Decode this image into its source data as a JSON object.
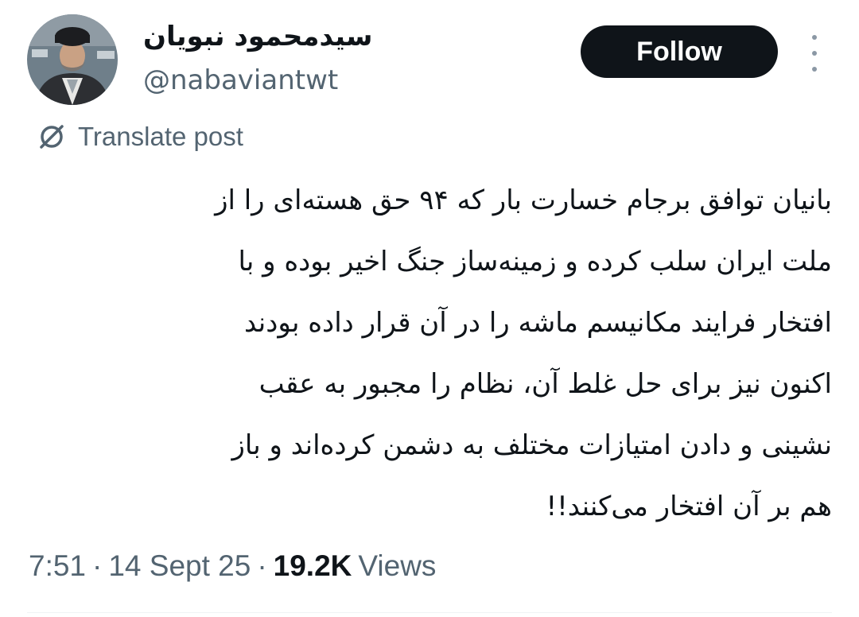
{
  "author": {
    "display_name": "سیدمحمود نبویان",
    "handle": "@nabaviantwt",
    "avatar_icon": "profile-photo"
  },
  "follow_button": {
    "label": "Follow"
  },
  "more_icon": "more-vertical-icon",
  "translate": {
    "label": "Translate post",
    "icon": "globe-slash-icon"
  },
  "tweet": {
    "text": "بانیان توافق برجام خسارت بار که ۹۴ حق هسته‌ای را از\nملت ایران سلب کرده و زمینه‌ساز جنگ اخیر بوده و با\nافتخار فرایند مکانیسم ماشه را در آن قرار داده بودند\nاکنون نیز برای حل غلط آن، نظام را مجبور به عقب\nنشینی  و دادن امتیازات مختلف به دشمن کرده‌اند و باز\nهم بر آن افتخار می‌کنند!!"
  },
  "meta": {
    "time": "7:51",
    "separator": "·",
    "date": "14 Sept 25",
    "views_count": "19.2K",
    "views_label": "Views"
  },
  "colors": {
    "text": "#0f1419",
    "secondary": "#536471",
    "button_bg": "#0f1419",
    "button_text": "#ffffff",
    "background": "#ffffff"
  }
}
